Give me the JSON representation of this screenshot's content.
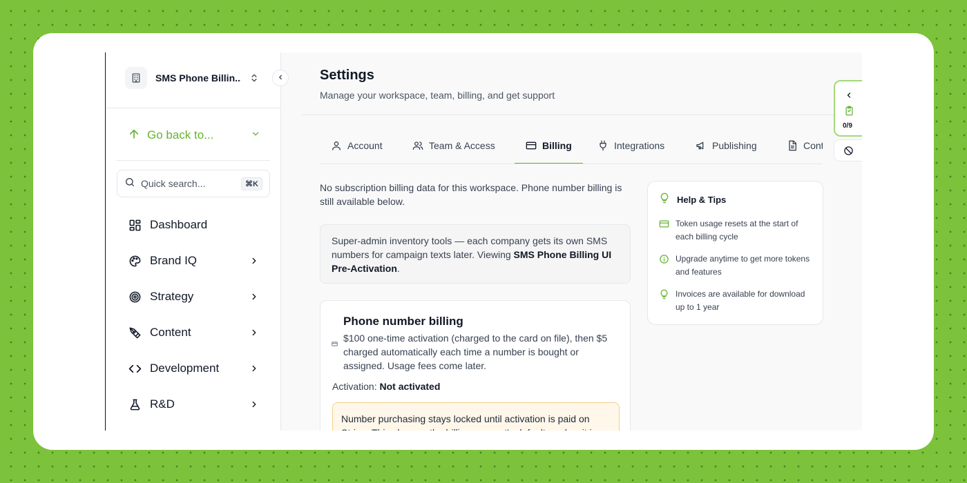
{
  "sidebar": {
    "workspace_name": "SMS Phone Billin...",
    "go_back": "Go back to...",
    "search_placeholder": "Quick search...",
    "search_shortcut": "⌘K",
    "items": [
      {
        "label": "Dashboard",
        "icon": "dashboard-icon",
        "has_children": false
      },
      {
        "label": "Brand IQ",
        "icon": "palette-icon",
        "has_children": true
      },
      {
        "label": "Strategy",
        "icon": "target-icon",
        "has_children": true
      },
      {
        "label": "Content",
        "icon": "pen-tool-icon",
        "has_children": true
      },
      {
        "label": "Development",
        "icon": "code-icon",
        "has_children": true
      },
      {
        "label": "R&D",
        "icon": "flask-icon",
        "has_children": true
      }
    ]
  },
  "header": {
    "title": "Settings",
    "subtitle": "Manage your workspace, team, billing, and get support"
  },
  "tabs": [
    {
      "label": "Account",
      "icon": "user-icon",
      "active": false
    },
    {
      "label": "Team & Access",
      "icon": "users-icon",
      "active": false
    },
    {
      "label": "Billing",
      "icon": "credit-card-icon",
      "active": true
    },
    {
      "label": "Integrations",
      "icon": "plug-icon",
      "active": false
    },
    {
      "label": "Publishing",
      "icon": "megaphone-icon",
      "active": false
    },
    {
      "label": "Cont",
      "icon": "file-icon",
      "active": false
    }
  ],
  "billing": {
    "intro": "No subscription billing data for this workspace. Phone number billing is still available below.",
    "admin_text_prefix": "Super-admin inventory tools — each company gets its own SMS numbers for campaign texts later. Viewing ",
    "admin_text_bold": "SMS Phone Billing UI Pre-Activation",
    "admin_text_suffix": ".",
    "phone_card": {
      "title": "Phone number billing",
      "description": "$100 one-time activation (charged to the card on file), then $5 charged automatically each time a number is bought or assigned. Usage fees come later.",
      "activation_label": "Activation:",
      "activation_value": "Not activated",
      "warning": "Number purchasing stays locked until activation is paid on Stripe. This charges the billing account's default card — it is"
    }
  },
  "tips": {
    "title": "Help & Tips",
    "items": [
      {
        "text": "Token usage resets at the start of each billing cycle",
        "icon": "credit-card-icon"
      },
      {
        "text": "Upgrade anytime to get more tokens and features",
        "icon": "info-icon"
      },
      {
        "text": "Invoices are available for download up to 1 year",
        "icon": "lightbulb-icon"
      }
    ]
  },
  "float_panel": {
    "count": "0/9"
  },
  "colors": {
    "accent": "#65b32e",
    "background": "#7cc23a",
    "warning_bg": "#fff7ea",
    "warning_border": "#f5cf8c"
  }
}
